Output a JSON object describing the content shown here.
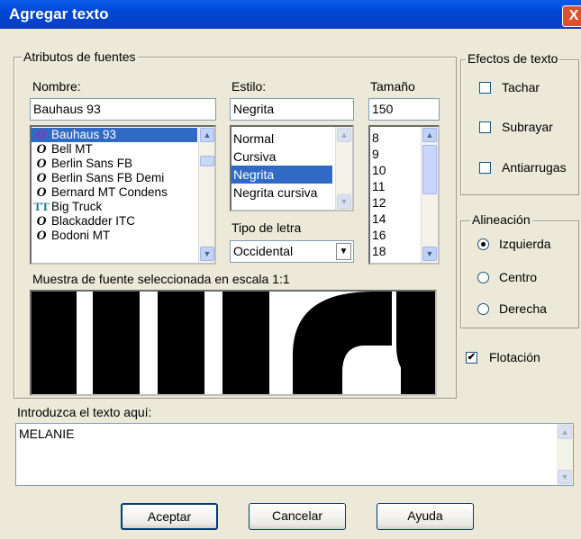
{
  "window": {
    "title": "Agregar texto",
    "close_glyph": "X"
  },
  "font_attributes": {
    "group_label": "Atributos de fuentes",
    "name_label": "Nombre:",
    "name_value": "Bauhaus 93",
    "fonts": [
      {
        "name": "Bauhaus 93",
        "icon": "O"
      },
      {
        "name": "Bell MT",
        "icon": "O"
      },
      {
        "name": "Berlin Sans FB",
        "icon": "O"
      },
      {
        "name": "Berlin Sans FB Demi",
        "icon": "O"
      },
      {
        "name": "Bernard MT Condens",
        "icon": "O"
      },
      {
        "name": "Big Truck",
        "icon": "TT"
      },
      {
        "name": "Blackadder ITC",
        "icon": "O"
      },
      {
        "name": "Bodoni MT",
        "icon": "O"
      }
    ],
    "style_label": "Estilo:",
    "style_value": "Negrita",
    "styles": [
      "Normal",
      "Cursiva",
      "Negrita",
      "Negrita cursiva"
    ],
    "size_label": "Tamaño",
    "size_value": "150",
    "sizes": [
      "8",
      "9",
      "10",
      "11",
      "12",
      "14",
      "16",
      "18"
    ],
    "script_label": "Tipo de letra",
    "script_value": "Occidental",
    "preview_label": "Muestra de fuente seleccionada en escala 1:1"
  },
  "effects": {
    "group_label": "Efectos de texto",
    "strike": "Tachar",
    "underline": "Subrayar",
    "antialias": "Antiarrugas"
  },
  "alignment": {
    "group_label": "Alineación",
    "left": "Izquierda",
    "center": "Centro",
    "right": "Derecha"
  },
  "float_label": "Flotación",
  "text_entry": {
    "label": "Introduzca el texto aquí:",
    "value": "MELANIE"
  },
  "buttons": {
    "ok": "Aceptar",
    "cancel": "Cancelar",
    "help": "Ayuda"
  },
  "colors": {
    "title_bar": "#0A5BE8",
    "selection": "#316AC5",
    "dialog_bg": "#ECE9D8",
    "font_icon_blue": "#3A2FB0",
    "font_icon_purple": "#9B2AA8",
    "font_icon_teal": "#1A7A8A"
  }
}
